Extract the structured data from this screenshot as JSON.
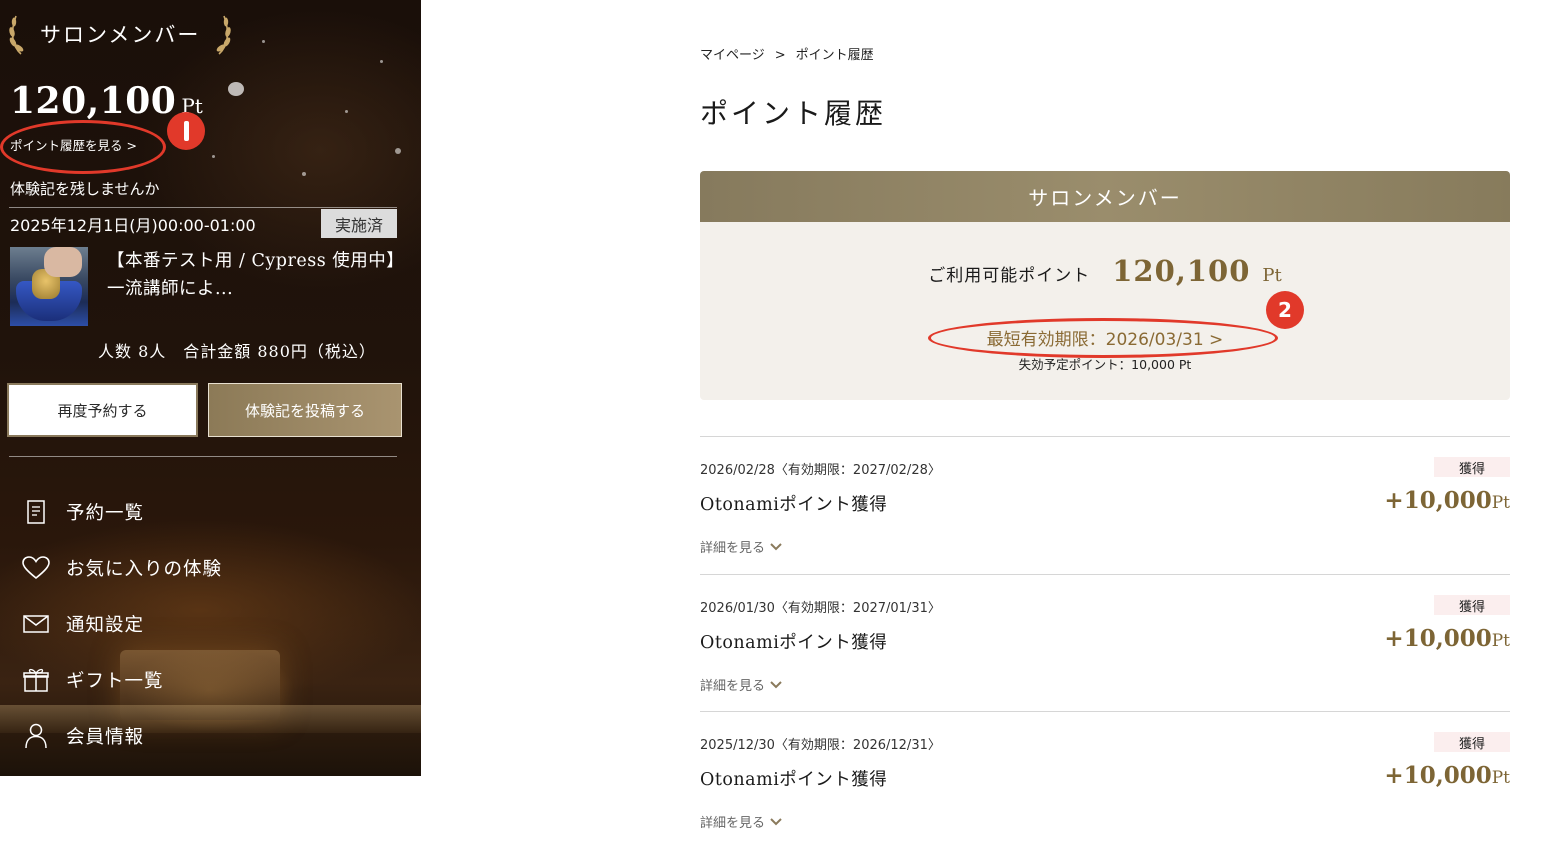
{
  "sidebar": {
    "rank_title": "サロンメンバー",
    "points_total": "120,100",
    "points_unit": "Pt",
    "history_link": "ポイント履歴を見る >",
    "review_prompt": "体験記を残しませんか",
    "booking": {
      "datetime": "2025年12月1日(月)00:00-01:00",
      "status": "実施済",
      "title": "【本番テスト用 / Cypress 使用中】一流講師によ...",
      "summary": "人数 8人　合計金額 880円（税込）"
    },
    "rebook_button": "再度予約する",
    "post_review_button": "体験記を投稿する",
    "nav": [
      {
        "label": "予約一覧",
        "icon": "document-icon"
      },
      {
        "label": "お気に入りの体験",
        "icon": "heart-icon"
      },
      {
        "label": "通知設定",
        "icon": "mail-icon"
      },
      {
        "label": "ギフト一覧",
        "icon": "gift-icon"
      },
      {
        "label": "会員情報",
        "icon": "user-icon"
      }
    ]
  },
  "annotations": {
    "badge_2": "2"
  },
  "main": {
    "breadcrumb": {
      "home": "マイページ",
      "separator": ">",
      "current": "ポイント履歴"
    },
    "title": "ポイント履歴",
    "card": {
      "rank": "サロンメンバー",
      "available_label": "ご利用可能ポイント",
      "available_points": "120,100",
      "available_unit": "Pt",
      "nearest_expiry": "最短有効期限：2026/03/31 >",
      "expiring_points": "失効予定ポイント：10,000 Pt"
    },
    "history": [
      {
        "date": "2026/02/28〈有効期限：2027/02/28〉",
        "tag": "獲得",
        "title": "Otonamiポイント獲得",
        "amount": "+10,000",
        "unit": "Pt",
        "detail": "詳細を見る"
      },
      {
        "date": "2026/01/30〈有効期限：2027/01/31〉",
        "tag": "獲得",
        "title": "Otonamiポイント獲得",
        "amount": "+10,000",
        "unit": "Pt",
        "detail": "詳細を見る"
      },
      {
        "date": "2025/12/30〈有効期限：2026/12/31〉",
        "tag": "獲得",
        "title": "Otonamiポイント獲得",
        "amount": "+10,000",
        "unit": "Pt",
        "detail": "詳細を見る"
      }
    ]
  },
  "colors": {
    "accent_gold": "#7d6535",
    "annotation_red": "#e1392a",
    "card_bg": "#f3f0eb"
  }
}
